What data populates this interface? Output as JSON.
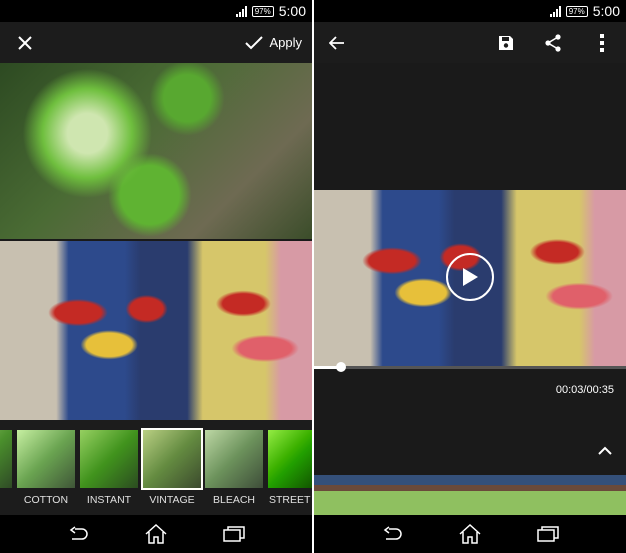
{
  "status": {
    "battery": "97%",
    "time": "5:00"
  },
  "left": {
    "toolbar": {
      "apply_label": "Apply"
    },
    "filters": [
      {
        "label": "COTTON"
      },
      {
        "label": "INSTANT"
      },
      {
        "label": "VINTAGE",
        "selected": true
      },
      {
        "label": "BLEACH"
      },
      {
        "label": "STREET"
      }
    ]
  },
  "right": {
    "video": {
      "time_display": "00:03/00:35",
      "progress": 0.086
    }
  }
}
